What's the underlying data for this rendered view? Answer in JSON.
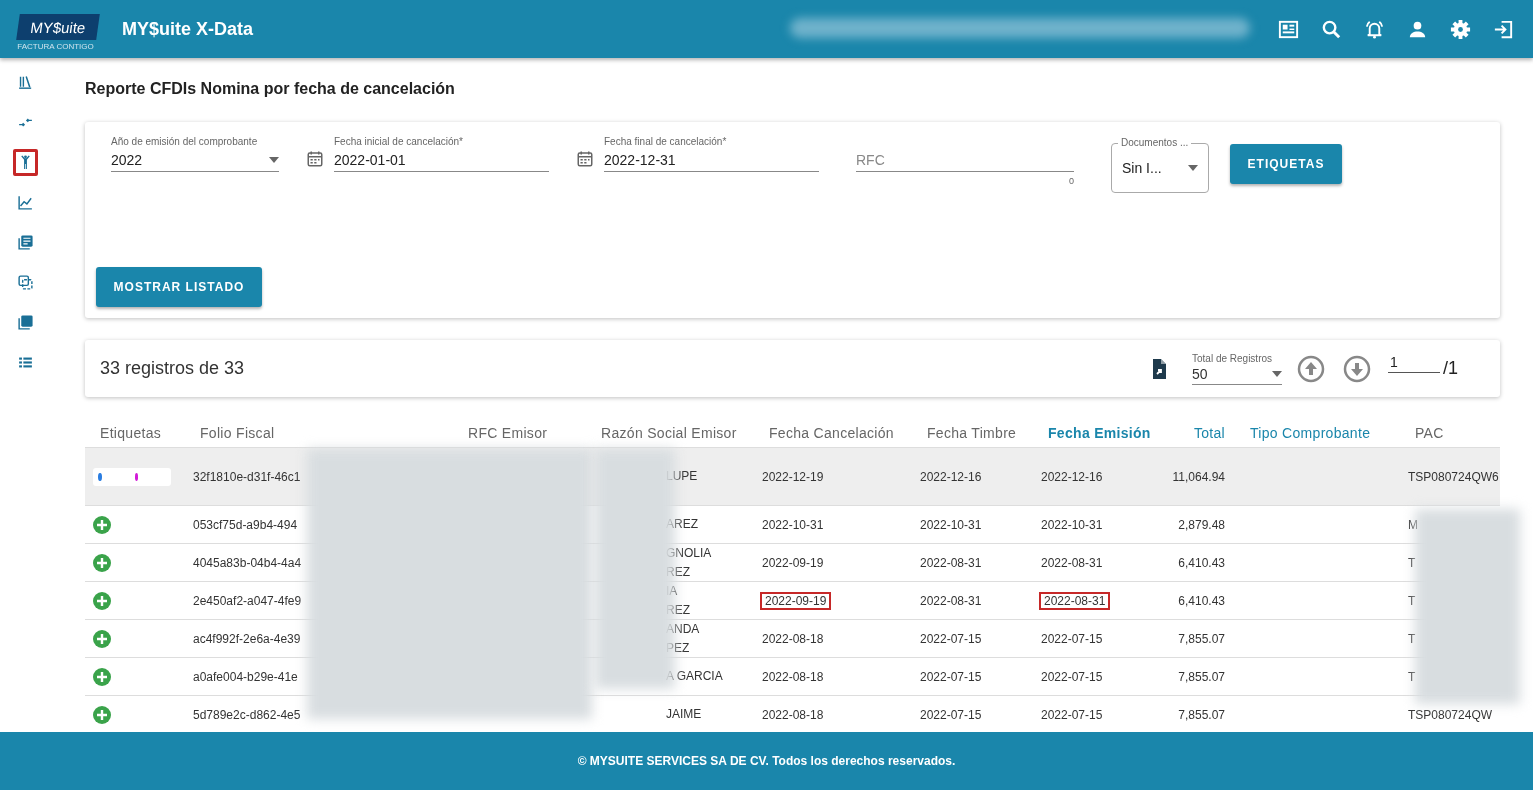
{
  "header": {
    "logo": "MY$uite",
    "logo_tagline": "FACTURA CONTIGO",
    "title": "MY$uite X-Data"
  },
  "sidebar": {
    "items": [
      {
        "highlighted": false
      },
      {
        "highlighted": false
      },
      {
        "highlighted": true
      },
      {
        "highlighted": false
      },
      {
        "highlighted": false
      },
      {
        "highlighted": false
      },
      {
        "highlighted": false
      },
      {
        "highlighted": false
      }
    ]
  },
  "page_title": "Reporte CFDIs Nomina por fecha de cancelación",
  "filters": {
    "fields": [
      {
        "kind": "select",
        "label": "Año de emisión del comprobante",
        "value": "2022"
      },
      {
        "kind": "date",
        "label": "Fecha inicial de cancelación*",
        "value": "2022-01-01"
      },
      {
        "kind": "date",
        "label": "Fecha final de cancelación*",
        "value": "2022-12-31"
      },
      {
        "kind": "text",
        "placeholder": "RFC",
        "counter": "0"
      },
      {
        "kind": "outlined",
        "label": "Documentos ...",
        "value": "Sin I..."
      }
    ],
    "tags_button": "ETIQUETAS",
    "show_button": "MOSTRAR LISTADO"
  },
  "results": {
    "count": "33 registros de 33",
    "page_size_label": "Total de Registros",
    "page_size": "50",
    "page": "1",
    "pages": "/1"
  },
  "table": {
    "columns": [
      {
        "label": "Etiquetas",
        "kind": "plain"
      },
      {
        "label": "Folio Fiscal",
        "kind": "plain"
      },
      {
        "label": "RFC Emisor",
        "kind": "plain"
      },
      {
        "label": "Razón Social Emisor",
        "kind": "plain"
      },
      {
        "label": "Fecha Cancelación",
        "kind": "plain"
      },
      {
        "label": "Fecha Timbre",
        "kind": "plain"
      },
      {
        "label": "Fecha Emisión",
        "kind": "sorted"
      },
      {
        "label": "Total",
        "kind": "link"
      },
      {
        "label": "Tipo Comprobante",
        "kind": "link"
      },
      {
        "label": "PAC",
        "kind": "plain"
      }
    ],
    "rows": [
      {
        "selected": true,
        "tags": [
          {
            "color": "#2a7de1"
          },
          {
            "color": "#d21ad8"
          }
        ],
        "folio": "32f1810e-d31f-46c1",
        "razon": "LUPE",
        "cancelacion": "2022-12-19",
        "timbre": "2022-12-16",
        "emision": "2022-12-16",
        "total": "11,064.94",
        "pac": "TSP080724QW6",
        "highlighted": false
      },
      {
        "selected": false,
        "folio": "053cf75d-a9b4-494",
        "razon": "AREZ",
        "cancelacion": "2022-10-31",
        "timbre": "2022-10-31",
        "emision": "2022-10-31",
        "total": "2,879.48",
        "pac": "M",
        "highlighted": false
      },
      {
        "selected": false,
        "folio": "4045a83b-04b4-4a4",
        "razon": "GNOLIA",
        "razon2": "REZ",
        "cancelacion": "2022-09-19",
        "timbre": "2022-08-31",
        "emision": "2022-08-31",
        "total": "6,410.43",
        "pac": "T",
        "highlighted": false
      },
      {
        "selected": false,
        "folio": "2e450af2-a047-4fe9",
        "razon": "IA",
        "razon2": "REZ",
        "cancelacion": "2022-09-19",
        "timbre": "2022-08-31",
        "emision": "2022-08-31",
        "total": "6,410.43",
        "pac": "T",
        "highlighted": true
      },
      {
        "selected": false,
        "folio": "ac4f992f-2e6a-4e39",
        "razon": "ANDA",
        "razon2": "PEZ",
        "cancelacion": "2022-08-18",
        "timbre": "2022-07-15",
        "emision": "2022-07-15",
        "total": "7,855.07",
        "pac": "T",
        "highlighted": false
      },
      {
        "selected": false,
        "folio": "a0afe004-b29e-41e",
        "razon": "A GARCIA",
        "cancelacion": "2022-08-18",
        "timbre": "2022-07-15",
        "emision": "2022-07-15",
        "total": "7,855.07",
        "pac": "T",
        "highlighted": false
      },
      {
        "selected": false,
        "folio": "5d789e2c-d862-4e5",
        "razon": "JAIME",
        "cancelacion": "2022-08-18",
        "timbre": "2022-07-15",
        "emision": "2022-07-15",
        "total": "7,855.07",
        "pac": "TSP080724QW",
        "highlighted": false
      }
    ]
  },
  "footer": "© MYSUITE SERVICES SA DE CV. Todos los derechos reservados."
}
